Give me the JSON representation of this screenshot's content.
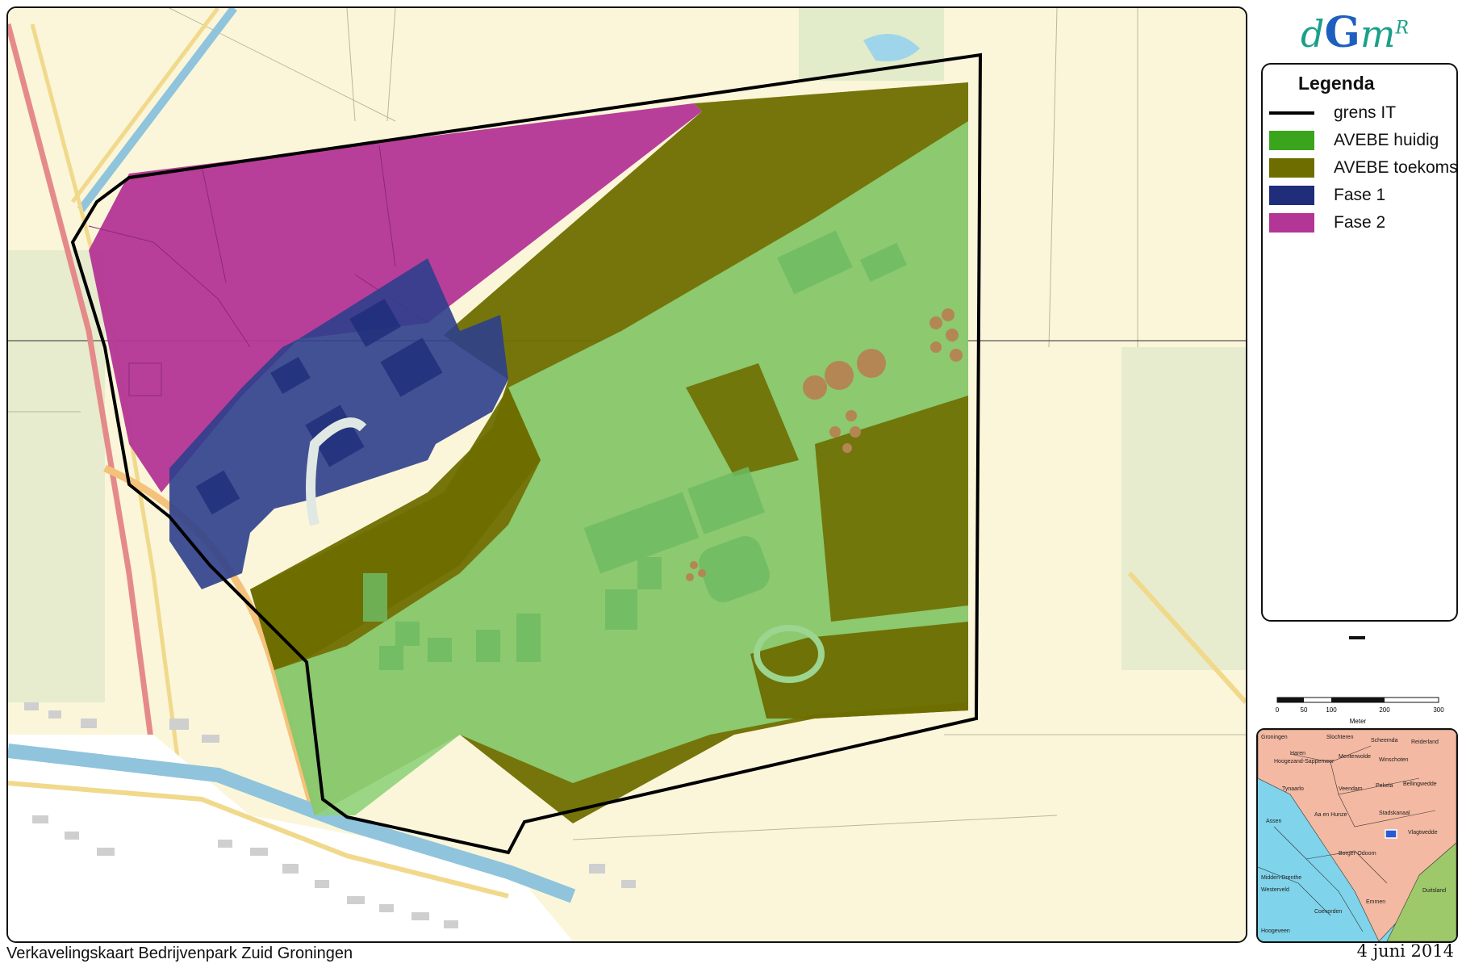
{
  "logo": {
    "d": "d",
    "g": "G",
    "m": "m",
    "r": "R"
  },
  "legend": {
    "title": "Legenda",
    "items": [
      {
        "label": "grens IT",
        "type": "line",
        "color": "#000000"
      },
      {
        "label": "AVEBE huidig",
        "type": "fill",
        "color": "#3aa51c"
      },
      {
        "label": "AVEBE toekomst",
        "type": "fill",
        "color": "#6e6e00"
      },
      {
        "label": "Fase 1",
        "type": "fill",
        "color": "#1f2d7a"
      },
      {
        "label": "Fase 2",
        "type": "fill",
        "color": "#b33596"
      }
    ]
  },
  "scalebar": {
    "ticks": [
      "0",
      "50",
      "100",
      "200",
      "300"
    ],
    "unit": "Meter"
  },
  "inset": {
    "places": [
      "Groningen",
      "Haren",
      "Slochteren",
      "Scheemda",
      "Reiderland",
      "Hoogezand-Sappemeer",
      "Menterwolde",
      "Winschoten",
      "Tynaarlo",
      "Veendam",
      "Pekela",
      "Bellingwedde",
      "Assen",
      "Aa en Hunze",
      "Stadskanaal",
      "Vlagtwedde",
      "Borger-Odoorn",
      "Midden-Drenthe",
      "Westerveld",
      "Emmen",
      "Coevorden",
      "Hoogeveen",
      "Duitsland"
    ]
  },
  "caption": "Verkavelingskaart Bedrijvenpark Zuid Groningen",
  "date": "4 juni 2014"
}
